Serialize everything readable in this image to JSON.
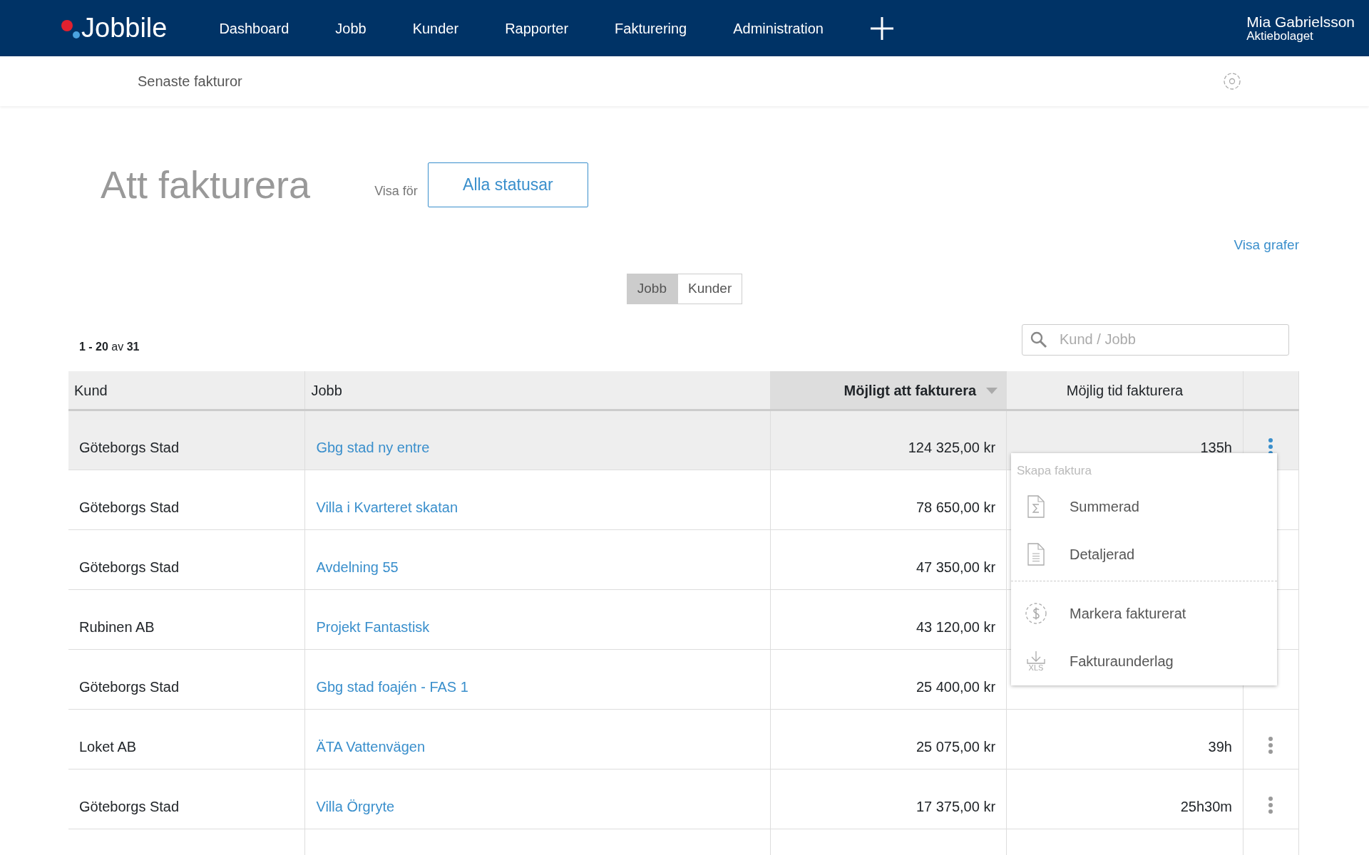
{
  "navbar": {
    "brand": "Jobbile",
    "items": [
      "Dashboard",
      "Jobb",
      "Kunder",
      "Rapporter",
      "Fakturering",
      "Administration"
    ],
    "user": {
      "name": "Mia Gabrielsson",
      "company": "Aktiebolaget"
    }
  },
  "subbar": {
    "link": "Senaste fakturor"
  },
  "page": {
    "title": "Att fakturera",
    "filter_label": "Visa för",
    "filter_button": "Alla statusar",
    "graph_link": "Visa grafer"
  },
  "view_toggle": [
    {
      "label": "Jobb",
      "selected": true
    },
    {
      "label": "Kunder",
      "selected": false
    }
  ],
  "pagination": "**1 - 20** av **31**",
  "search": {
    "placeholder": "Kund / Jobb"
  },
  "table": {
    "columns": [
      {
        "label": "Kund",
        "sorted": false
      },
      {
        "label": "Jobb",
        "sorted": false
      },
      {
        "label": "Möjligt att fakturera",
        "sorted": true
      },
      {
        "label": "Möjlig tid fakturera",
        "sorted": false
      }
    ],
    "rows": [
      {
        "customer": "Göteborgs Stad",
        "job": "Gbg stad ny entre",
        "amount": "124 325,00 kr",
        "hours": "135h",
        "selected": true
      },
      {
        "customer": "Göteborgs Stad",
        "job": "Villa i Kvarteret skatan",
        "amount": "78 650,00 kr",
        "selected": false
      },
      {
        "customer": "Göteborgs Stad",
        "job": "Avdelning 55",
        "amount": "47 350,00 kr",
        "selected": false
      },
      {
        "customer": "Rubinen AB",
        "job": "Projekt Fantastisk",
        "amount": "43 120,00 kr",
        "selected": false
      },
      {
        "customer": "Göteborgs Stad",
        "job": "Gbg stad foajén - FAS 1",
        "amount": "25 400,00 kr",
        "selected": false
      },
      {
        "customer": "Loket AB",
        "job": "ÄTA Vattenvägen",
        "amount": "25 075,00 kr",
        "hours": "39h",
        "selected": false
      },
      {
        "customer": "Göteborgs Stad",
        "job": "Villa Örgryte",
        "amount": "17 375,00 kr",
        "hours": "25h30m",
        "selected": false
      }
    ]
  },
  "row_menu": {
    "title": "Skapa faktura",
    "groups": [
      [
        {
          "label": "Summerad"
        },
        {
          "label": "Detaljerad"
        }
      ],
      [
        {
          "label": "Markera fakturerat"
        },
        {
          "label": "Fakturaunderlag",
          "icon_label": "XLS"
        }
      ]
    ]
  }
}
